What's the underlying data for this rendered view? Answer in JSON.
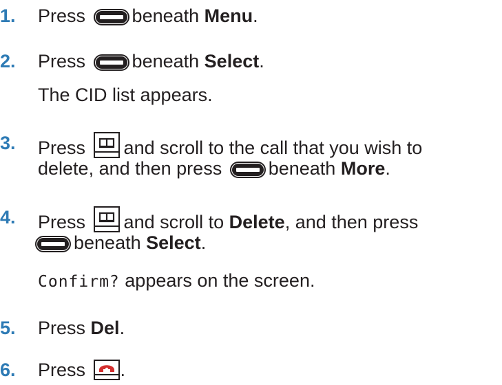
{
  "steps": [
    {
      "number": "1.",
      "press": "Press",
      "beneath": "beneath",
      "target": "Menu",
      "period": "."
    },
    {
      "number": "2.",
      "press": "Press",
      "beneath": "beneath",
      "target": "Select",
      "period": ".",
      "note": "The CID list appears."
    },
    {
      "number": "3.",
      "press": "Press",
      "after_key": "and scroll to the call that you wish to",
      "line2": "delete, and then press",
      "beneath": "beneath",
      "target": "More",
      "period": "."
    },
    {
      "number": "4.",
      "press": "Press",
      "after_key": "and scroll to",
      "delete_label": "Delete",
      "then_press": ", and then press",
      "beneath": "beneath",
      "target": "Select",
      "period": ".",
      "note_mono": "Confirm?",
      "note_rest": " appears on the screen."
    },
    {
      "number": "5.",
      "press": "Press",
      "target": "Del",
      "period": "."
    },
    {
      "number": "6.",
      "press": "Press",
      "period": "."
    }
  ],
  "icons": {
    "softkey": "softkey-button-icon",
    "phonebook": "phonebook-key-icon",
    "endcall": "end-call-key-icon"
  },
  "colors": {
    "step_number": "#2e7bb5",
    "text": "#231f20",
    "end_call_red": "#d32f2f"
  }
}
